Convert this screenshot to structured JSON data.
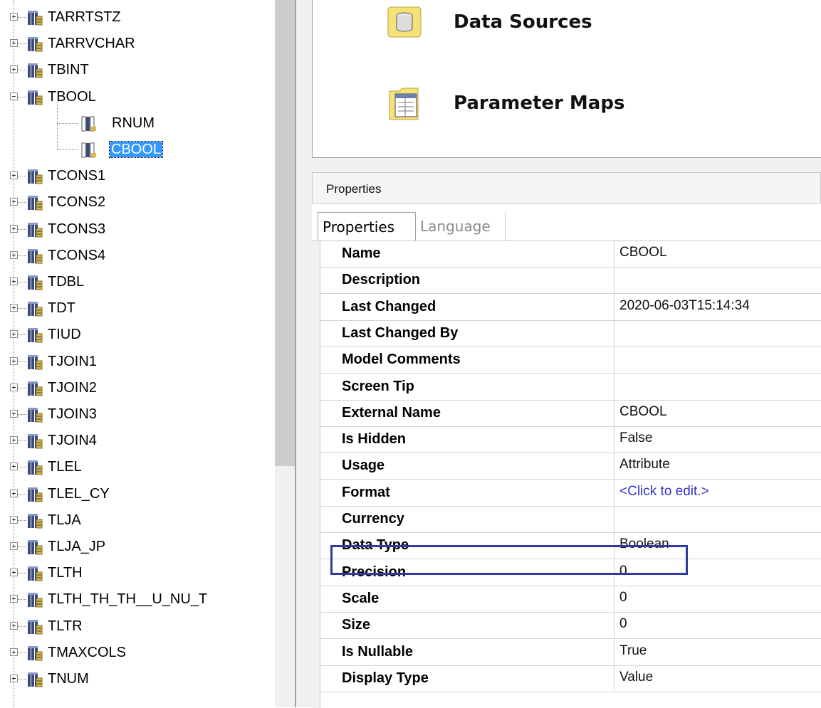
{
  "tree": {
    "nodes_before": [
      {
        "label": "TARRTSTZ",
        "expanded": false
      },
      {
        "label": "TARRVCHAR",
        "expanded": false
      },
      {
        "label": "TBINT",
        "expanded": false
      },
      {
        "label": "TBOOL",
        "expanded": true
      }
    ],
    "children": [
      {
        "label": "RNUM",
        "selected": false
      },
      {
        "label": "CBOOL",
        "selected": true
      }
    ],
    "nodes_after": [
      {
        "label": "TCONS1"
      },
      {
        "label": "TCONS2"
      },
      {
        "label": "TCONS3"
      },
      {
        "label": "TCONS4"
      },
      {
        "label": "TDBL"
      },
      {
        "label": "TDT"
      },
      {
        "label": "TIUD"
      },
      {
        "label": "TJOIN1"
      },
      {
        "label": "TJOIN2"
      },
      {
        "label": "TJOIN3"
      },
      {
        "label": "TJOIN4"
      },
      {
        "label": "TLEL"
      },
      {
        "label": "TLEL_CY"
      },
      {
        "label": "TLJA"
      },
      {
        "label": "TLJA_JP"
      },
      {
        "label": "TLTH"
      },
      {
        "label": "TLTH_TH_TH__U_NU_T"
      },
      {
        "label": "TLTR"
      },
      {
        "label": "TMAXCOLS"
      },
      {
        "label": "TNUM"
      }
    ]
  },
  "top_panel": {
    "data_sources_label": "Data Sources",
    "parameter_maps_label": "Parameter Maps"
  },
  "properties_pane": {
    "header": "Properties",
    "tabs": [
      {
        "label": "Properties",
        "active": true
      },
      {
        "label": "Language",
        "active": false
      }
    ],
    "rows": [
      {
        "name": "Name",
        "value": "CBOOL"
      },
      {
        "name": "Description",
        "value": ""
      },
      {
        "name": "Last Changed",
        "value": "2020-06-03T15:14:34"
      },
      {
        "name": "Last Changed By",
        "value": ""
      },
      {
        "name": "Model Comments",
        "value": ""
      },
      {
        "name": "Screen Tip",
        "value": ""
      },
      {
        "name": "External Name",
        "value": "CBOOL"
      },
      {
        "name": "Is Hidden",
        "value": "False"
      },
      {
        "name": "Usage",
        "value": "Attribute"
      },
      {
        "name": "Format",
        "value": "<Click to edit.>",
        "link": true
      },
      {
        "name": "Currency",
        "value": ""
      },
      {
        "name": "Data Type",
        "value": "Boolean",
        "highlighted": true
      },
      {
        "name": "Precision",
        "value": "0"
      },
      {
        "name": "Scale",
        "value": "0"
      },
      {
        "name": "Size",
        "value": "0"
      },
      {
        "name": "Is Nullable",
        "value": "True"
      },
      {
        "name": "Display Type",
        "value": "Value"
      }
    ]
  },
  "colors": {
    "selection": "#3399ff",
    "highlight_box": "#2e3a9c",
    "link": "#3333cc"
  }
}
